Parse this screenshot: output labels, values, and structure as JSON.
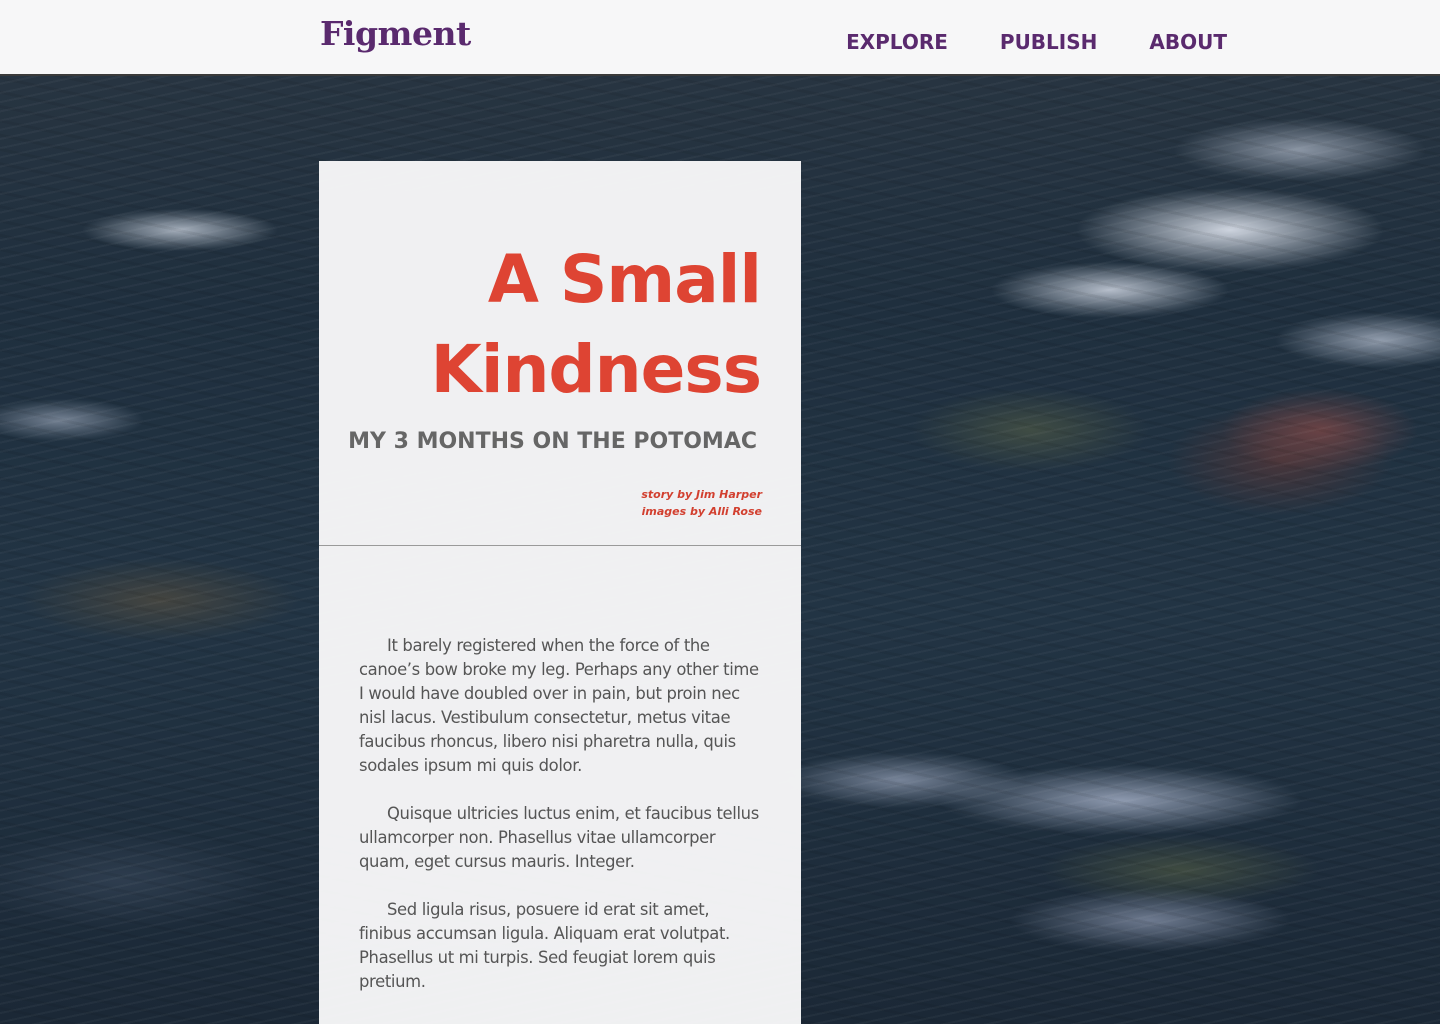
{
  "header": {
    "logo": "Figment",
    "nav": [
      "EXPLORE",
      "PUBLISH",
      "ABOUT"
    ]
  },
  "story": {
    "title_line1": "A Small",
    "title_line2": "Kindness",
    "subtitle": "MY 3 MONTHS ON THE POTOMAC",
    "credit_story": "story by Jim Harper",
    "credit_images": "images by Alli Rose",
    "paragraphs": [
      "It barely registered when the force of the canoe’s bow broke my leg. Perhaps any other time I would have doubled over in pain, but proin nec nisl lacus. Vestibulum consectetur, metus vitae faucibus rhoncus, libero nisi pharetra nulla, quis sodales ipsum mi quis dolor.",
      "Quisque ultricies luctus enim, et faucibus tellus ullamcorper non. Phasellus vitae ullamcorper quam, eget cursus mauris. Integer.",
      "Sed ligula risus, posuere id erat sit amet, finibus accumsan ligula. Aliquam erat volutpat. Phasellus ut mi turpis. Sed feugiat lorem quis pretium."
    ]
  },
  "colors": {
    "brand": "#5a2a6e",
    "title": "#de4433",
    "subtitle": "#666666",
    "body_text": "#555555"
  }
}
